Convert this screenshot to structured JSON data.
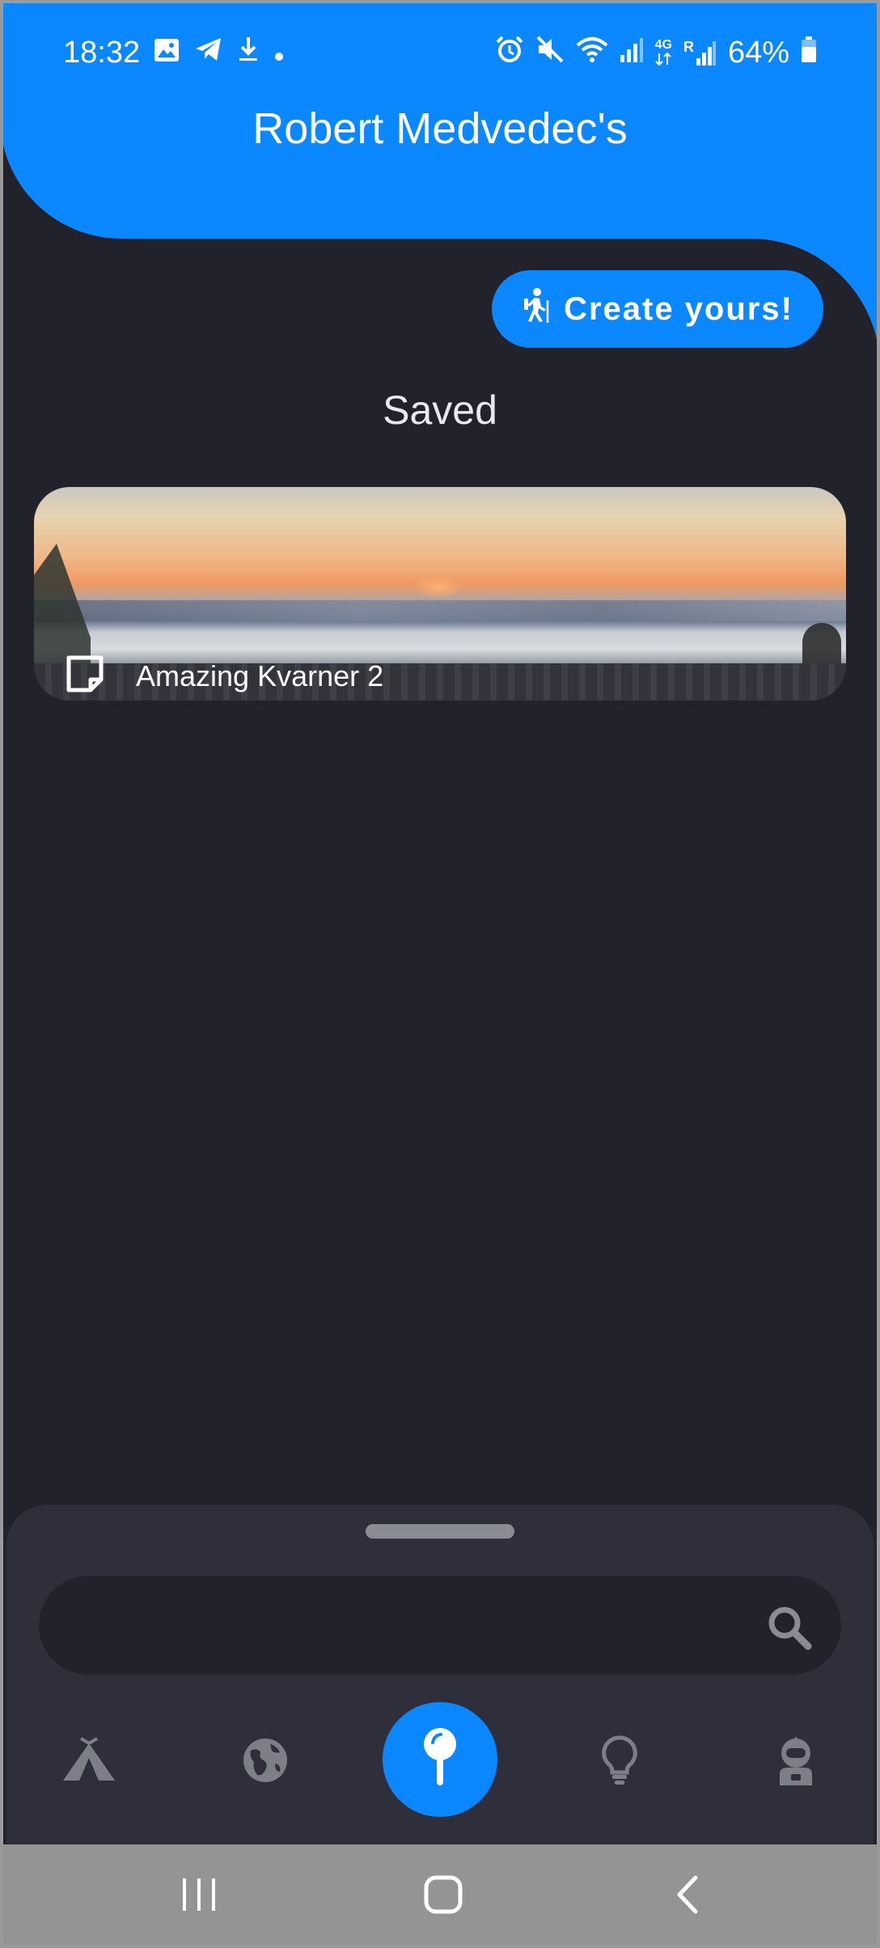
{
  "status_bar": {
    "time": "18:32",
    "battery": "64%",
    "left_icons": [
      "image-icon",
      "telegram-icon",
      "download-icon",
      "dot-icon"
    ],
    "right_icons": [
      "alarm-icon",
      "mute-icon",
      "wifi-icon",
      "signal-icon",
      "signal-4g-icon",
      "signal-roaming-icon",
      "battery-icon"
    ],
    "network_label_4g": "4G",
    "network_label_r": "R"
  },
  "header": {
    "title": "Robert Medvedec's",
    "color": "#0b87ff"
  },
  "create_button": {
    "label": "Create yours!",
    "icon": "hiker-icon"
  },
  "saved": {
    "heading": "Saved",
    "items": [
      {
        "label": "Amazing Kvarner 2",
        "icon": "note-icon"
      }
    ]
  },
  "search": {
    "value": "",
    "placeholder": "",
    "icon": "search-icon"
  },
  "bottom_nav": {
    "items": [
      {
        "name": "tent-icon",
        "active": false
      },
      {
        "name": "globe-icon",
        "active": false
      },
      {
        "name": "pin-icon",
        "active": true
      },
      {
        "name": "lightbulb-icon",
        "active": false
      },
      {
        "name": "astronaut-icon",
        "active": false
      }
    ],
    "active_color": "#0b87ff",
    "inactive_color": "#7c7e88"
  },
  "system_nav": {
    "items": [
      "recents-icon",
      "home-icon",
      "back-icon"
    ]
  }
}
